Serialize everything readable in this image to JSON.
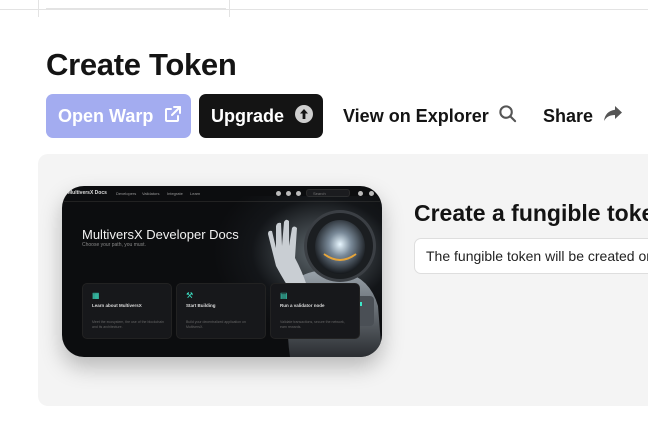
{
  "page": {
    "title": "Create Token"
  },
  "actions": {
    "open_warp": "Open Warp",
    "upgrade": "Upgrade",
    "view_on_explorer": "View on Explorer",
    "share": "Share"
  },
  "preview": {
    "nav_logo": "MultiversX Docs",
    "nav_links": [
      "Developers",
      "Validators",
      "Integrate",
      "Learn"
    ],
    "search_placeholder": "Search",
    "heading": "MultiversX Developer Docs",
    "subheading": "Choose your path, you must.",
    "cards": [
      {
        "icon": "grid-icon",
        "title": "Learn about MultiversX",
        "text": "Meet the ecosystem, the use of the blockchain and its architecture."
      },
      {
        "icon": "hammer-icon",
        "title": "Start Building",
        "text": "Build your decentralized application on MultiversX."
      },
      {
        "icon": "server-icon",
        "title": "Run a validator node",
        "text": "Validate transactions, secure the network, earn rewards."
      }
    ]
  },
  "section": {
    "heading": "Create a fungible token",
    "description": "The fungible token will be created on the MultiversX network"
  },
  "colors": {
    "warp_button": "#a3acf0",
    "upgrade_button": "#141414",
    "panel_bg": "#f4f4f4",
    "accent_teal": "#3ee6c8"
  }
}
